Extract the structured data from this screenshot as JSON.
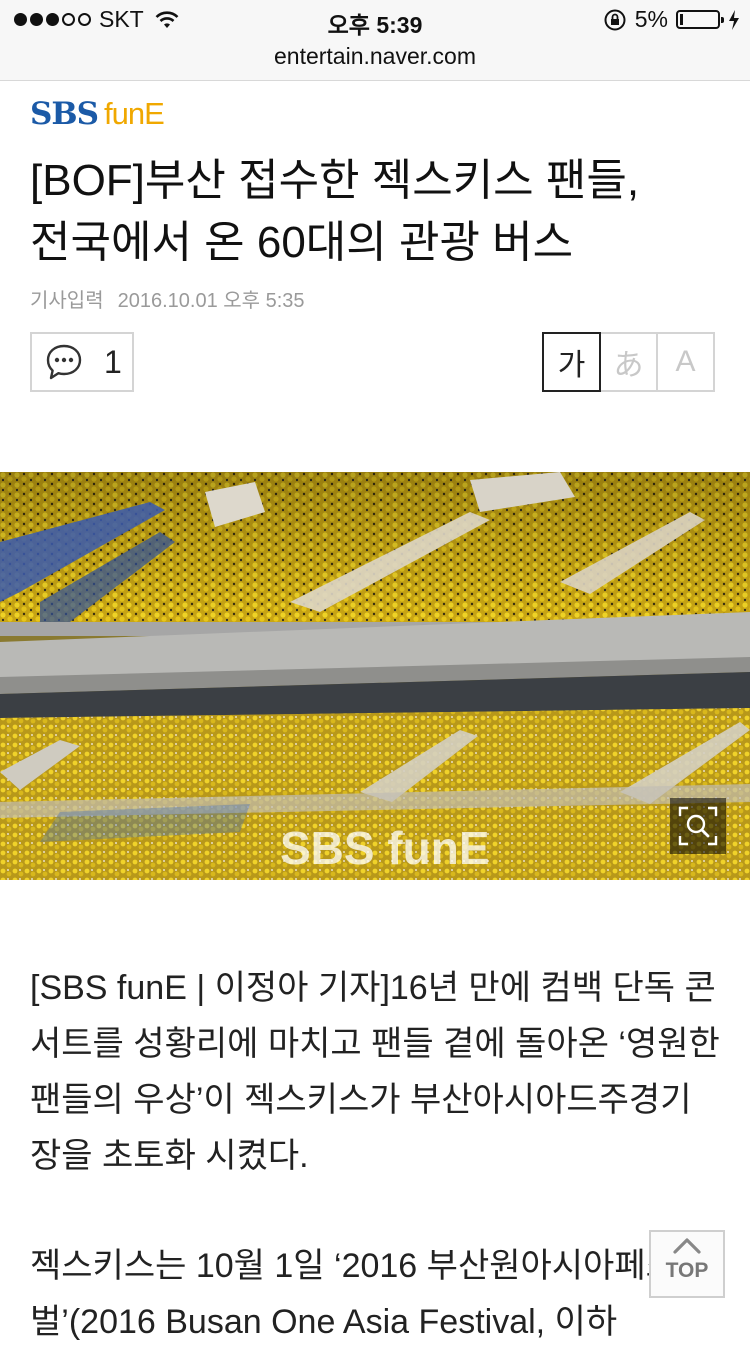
{
  "status_bar": {
    "carrier": "SKT",
    "time": "오후 5:39",
    "battery_text": "5%",
    "signal_bars_filled": 3,
    "signal_bars_total": 5,
    "battery_level": 0.05
  },
  "url_bar": {
    "url": "entertain.naver.com"
  },
  "header": {
    "logo_sbs": "SBS",
    "logo_fune": "funE"
  },
  "article": {
    "headline_line1": "[BOF]부산 접수한 젝스키스 팬들,",
    "headline_line2": "전국에서 온 60대의 관광 버스",
    "date_label": "기사입력",
    "date_value": "2016.10.01 오후 5:35",
    "paragraph1": "[SBS funE | 이정아 기자]16년 만에 컴백 단독 콘서트를 성황리에 마치고 팬들 곁에 돌아온 ‘영원한 팬들의 우상’이 젝스키스가 부산아시아드주경기장을 초토화 시켰다.",
    "paragraph2": "젝스키스는 10월 1일 ‘2016 부산원아시아페스티벌’(2016 Busan One Asia Festival, 이하"
  },
  "toolbar": {
    "comment_count": "1",
    "font_options": [
      "가",
      "あ",
      "A"
    ],
    "selected_font": "가"
  },
  "photo": {
    "watermark": "SBS funE"
  },
  "buttons": {
    "top_label": "TOP"
  },
  "colors": {
    "logo_blue": "#1b5aa7",
    "logo_orange": "#f0a800",
    "fan_yellow": "#e8c71a",
    "seat_blue": "#2b4fa0"
  },
  "icons": {
    "comment": "speech-bubble-icon",
    "zoom": "magnifier-icon",
    "top": "chevron-up-icon",
    "wifi": "wifi-icon",
    "rotation_lock": "rotation-lock-icon",
    "charging": "bolt-icon"
  }
}
